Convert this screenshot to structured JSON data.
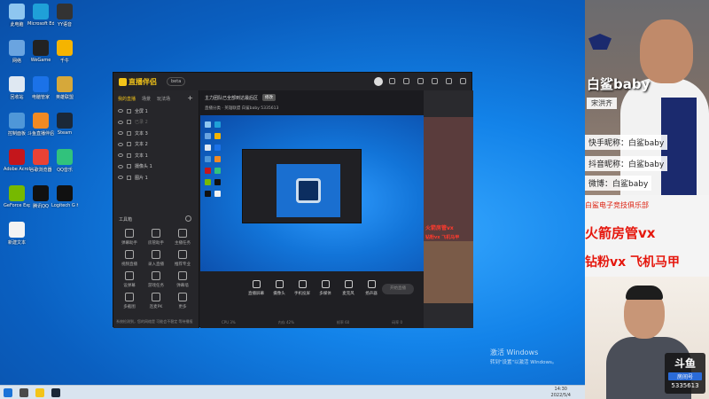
{
  "desktop": {
    "icons": [
      {
        "label": "此电脑",
        "color": "#8ec6f0"
      },
      {
        "label": "Microsoft Edge",
        "color": "#1fa0d8"
      },
      {
        "label": "YY语音",
        "color": "#333333"
      },
      {
        "label": "网络",
        "color": "#6aa4e0"
      },
      {
        "label": "WeGame",
        "color": "#222222"
      },
      {
        "label": "千牛",
        "color": "#f5b400"
      },
      {
        "label": "回收站",
        "color": "#dfe8f2"
      },
      {
        "label": "电脑管家",
        "color": "#1b72e8"
      },
      {
        "label": "英雄联盟",
        "color": "#d6a83a"
      },
      {
        "label": "控制面板",
        "color": "#4f97d8"
      },
      {
        "label": "斗鱼直播伴侣",
        "color": "#f08a24"
      },
      {
        "label": "Steam",
        "color": "#1b2838"
      },
      {
        "label": "Adobe Acrobat",
        "color": "#c4161c"
      },
      {
        "label": "谷歌浏览器",
        "color": "#e94235"
      },
      {
        "label": "QQ音乐",
        "color": "#31c27c"
      },
      {
        "label": "GeForce Experience",
        "color": "#76b900"
      },
      {
        "label": "腾讯QQ",
        "color": "#111111"
      },
      {
        "label": "Logitech G HUB",
        "color": "#111111"
      },
      {
        "label": "新建文本",
        "color": "#f3f3f3"
      }
    ],
    "activate_line1": "激活 Windows",
    "activate_line2": "转到\"设置\"以激活 Windows。"
  },
  "app": {
    "logo": "直播伴侣",
    "version": "beta",
    "tabs": [
      "我的直播",
      "场景",
      "玩法场"
    ],
    "layers": [
      {
        "name": "全屏 1",
        "dim": false
      },
      {
        "name": "已录 2",
        "dim": true
      },
      {
        "name": "文本 3",
        "dim": false
      },
      {
        "name": "文本 2",
        "dim": false
      },
      {
        "name": "文本 1",
        "dim": false
      },
      {
        "name": "摄像头 1",
        "dim": false
      },
      {
        "name": "图片 1",
        "dim": false
      }
    ],
    "tools_title": "工具箱",
    "tools": [
      "弹幕助手",
      "房管助手",
      "主播任务",
      "视频直播",
      "录入直播",
      "推荐专业",
      "设弹幕",
      "游戏任务",
      "弹幕墙",
      "多截图",
      "连麦PK",
      "更多"
    ],
    "status_left": "系统检测到，您的网络是 可能会不稳定 等待播报",
    "room_title": "主力团队已全部到达最后区",
    "room_tag": "修改",
    "room_sub": "直播分类 · 英雄联盟   白鲨baby   5335613",
    "bottom_items": [
      "直播屏幕",
      "摄像头",
      "手机投屏",
      "多媒体",
      "麦克风",
      "扬声器"
    ],
    "start_live": "开始直播",
    "mini_status": [
      "CPU 3%",
      "内存 42%",
      "帧率 60",
      "码率 0"
    ],
    "right_red": [
      "火箭房管vx",
      "钻粉vx 飞机马甲"
    ]
  },
  "taskbar": {
    "time": "14:30",
    "date": "2022/5/4"
  },
  "overlay": {
    "name": "白鲨baby",
    "subname": "宋洪齐",
    "lines": [
      "快手昵称：白鲨baby",
      "抖音昵称：白鲨baby",
      "微博：白鲨baby"
    ],
    "red_small": "白鲨电子竞技俱乐部",
    "red_big_1": "火箭房管vx",
    "red_big_2": "钻粉vx 飞机马甲",
    "badge_title": "斗鱼",
    "badge_sub": "房间号",
    "badge_room": "5335613"
  }
}
